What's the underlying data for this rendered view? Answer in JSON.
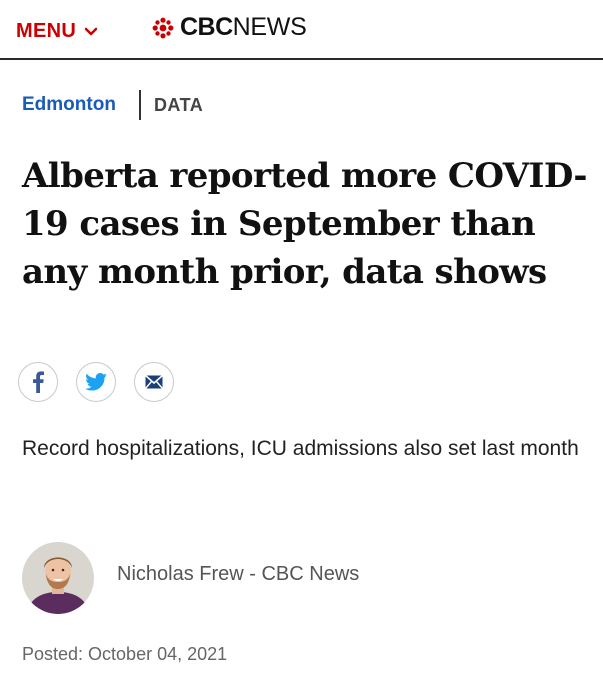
{
  "header": {
    "menu_label": "MENU",
    "brand_cbc": "CBC",
    "brand_news": "NEWS",
    "logo_icon": "cbc-gem-icon",
    "accent_color": "#cc0000"
  },
  "breadcrumb": {
    "region": "Edmonton",
    "section": "DATA",
    "region_color": "#1a5ab8"
  },
  "article": {
    "headline": "Alberta reported more COVID-19 cases in September than any month prior, data shows",
    "deck": "Record hospitalizations, ICU admissions also set last month",
    "byline": "Nicholas Frew - CBC News",
    "posted": "Posted: October 04, 2021"
  },
  "share": [
    {
      "icon": "facebook-icon",
      "color": "#3b5998"
    },
    {
      "icon": "twitter-icon",
      "color": "#1da1f2"
    },
    {
      "icon": "email-icon",
      "color": "#1a3f7a"
    }
  ]
}
